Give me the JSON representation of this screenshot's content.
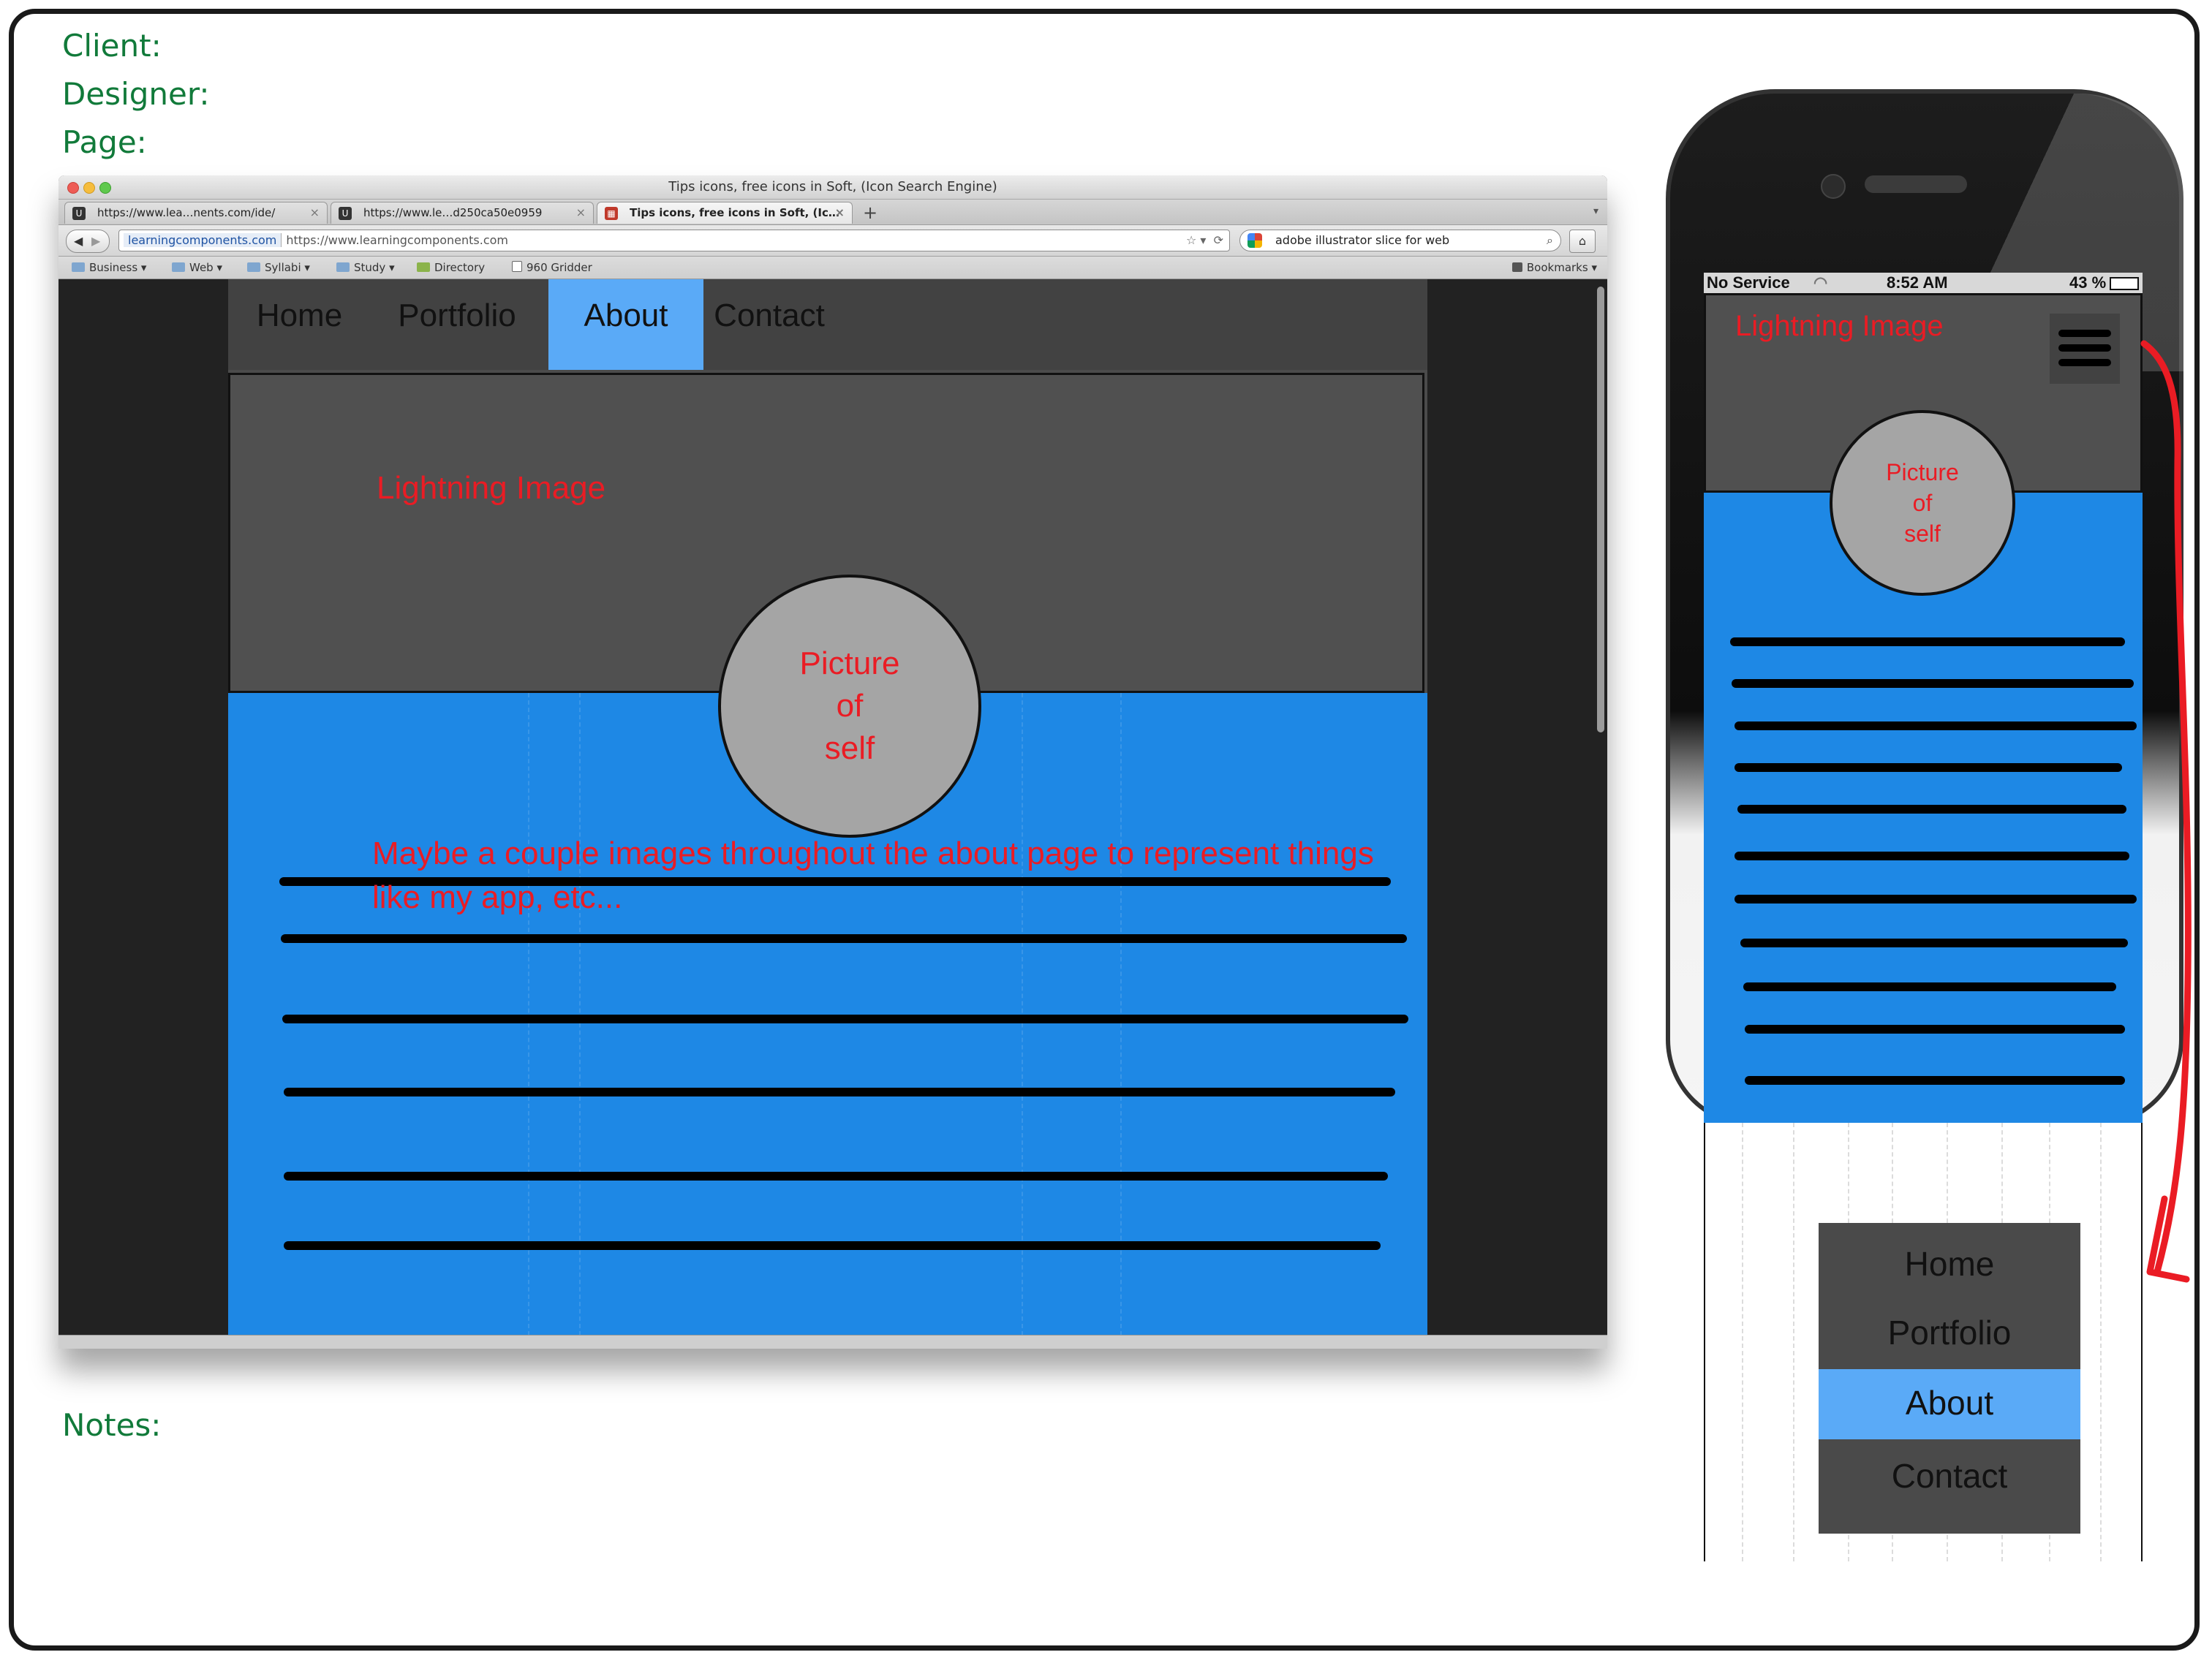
{
  "wireframe": {
    "labels": {
      "client": "Client:",
      "designer": "Designer:",
      "page": "Page:",
      "notes": "Notes:"
    }
  },
  "browser": {
    "window_title": "Tips icons, free icons in Soft, (Icon Search Engine)",
    "tabs": [
      {
        "label": "https://www.lea…nents.com/ide/",
        "active": false
      },
      {
        "label": "https://www.le…d250ca50e0959",
        "active": false
      },
      {
        "label": "Tips icons, free icons in Soft, (Ic…",
        "active": true
      }
    ],
    "new_tab_label": "+",
    "url_domain": "learningcomponents.com",
    "url_full": "https://www.learningcomponents.com",
    "search_text": "adobe illustrator slice for web",
    "bookmarks": [
      "Business",
      "Web",
      "Syllabi",
      "Study",
      "Directory",
      "960 Gridder"
    ],
    "bookmarks_menu": "Bookmarks"
  },
  "site": {
    "nav": [
      {
        "label": "Home",
        "active": false
      },
      {
        "label": "Portfolio",
        "active": false
      },
      {
        "label": "About",
        "active": true
      },
      {
        "label": "Contact",
        "active": false
      }
    ],
    "hero_note": "Lightning Image",
    "avatar_lines": [
      "Picture",
      "of",
      "self"
    ],
    "content_note": "Maybe a couple images throughout the about page to represent things like my app, etc..."
  },
  "phone": {
    "status": {
      "carrier": "No Service",
      "time": "8:52 AM",
      "battery": "43 %"
    },
    "hero_note": "Lightning Image",
    "avatar_lines": [
      "Picture",
      "of",
      "self"
    ],
    "menu": [
      {
        "label": "Home",
        "active": false
      },
      {
        "label": "Portfolio",
        "active": false
      },
      {
        "label": "About",
        "active": true
      },
      {
        "label": "Contact",
        "active": false
      }
    ]
  },
  "colors": {
    "label_green": "#117a3a",
    "annotation_red": "#ea1c24",
    "active_nav": "#5aaaf7",
    "content_blue": "#1e88e5",
    "hero_gray": "#505050"
  },
  "icons": [
    "close-dot-icon",
    "minimize-dot-icon",
    "zoom-dot-icon",
    "back-icon",
    "forward-icon",
    "star-icon",
    "reload-icon",
    "search-icon",
    "home-icon",
    "folder-icon",
    "hamburger-menu-icon",
    "wifi-icon",
    "battery-icon",
    "arrow-annotation-icon"
  ]
}
